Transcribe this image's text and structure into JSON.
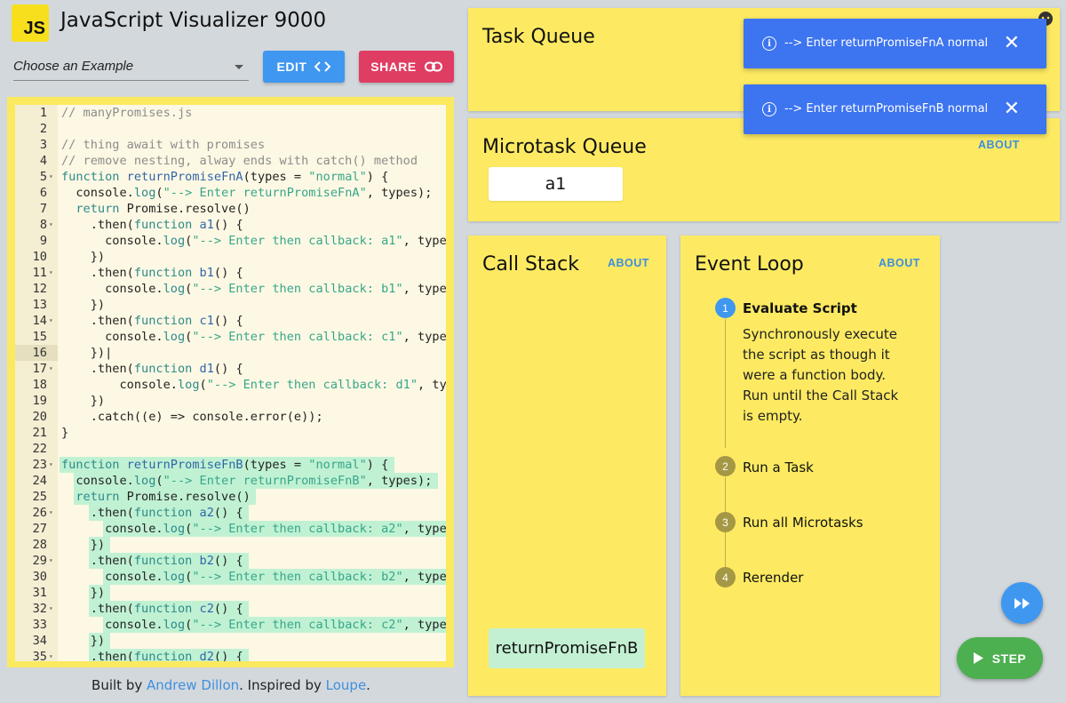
{
  "app": {
    "logo_text": "JS",
    "title": "JavaScript Visualizer 9000"
  },
  "toolbar": {
    "example_placeholder": "Choose an Example",
    "edit_label": "EDIT",
    "share_label": "SHARE"
  },
  "editor": {
    "active_line": 16,
    "highlight_start": 23,
    "lines": [
      {
        "n": "1",
        "fold": "",
        "code": "// manyPromises.js",
        "kind": "comment"
      },
      {
        "n": "2",
        "fold": "",
        "code": "",
        "kind": "plain"
      },
      {
        "n": "3",
        "fold": "",
        "code": "// thing await with promises",
        "kind": "comment"
      },
      {
        "n": "4",
        "fold": "",
        "code": "// remove nesting, alway ends with catch() method",
        "kind": "comment"
      },
      {
        "n": "5",
        "fold": "▾",
        "code": "function returnPromiseFnA(types = \"normal\") {",
        "kind": "fndecl"
      },
      {
        "n": "6",
        "fold": "",
        "code": "  console.log(\"--> Enter returnPromiseFnA\", types);",
        "kind": "log"
      },
      {
        "n": "7",
        "fold": "",
        "code": "  return Promise.resolve()",
        "kind": "return"
      },
      {
        "n": "8",
        "fold": "▾",
        "code": "    .then(function a1() {",
        "kind": "then"
      },
      {
        "n": "9",
        "fold": "",
        "code": "      console.log(\"--> Enter then callback: a1\", type",
        "kind": "log"
      },
      {
        "n": "10",
        "fold": "",
        "code": "    })",
        "kind": "plain"
      },
      {
        "n": "11",
        "fold": "▾",
        "code": "    .then(function b1() {",
        "kind": "then"
      },
      {
        "n": "12",
        "fold": "",
        "code": "      console.log(\"--> Enter then callback: b1\", type",
        "kind": "log"
      },
      {
        "n": "13",
        "fold": "",
        "code": "    })",
        "kind": "plain"
      },
      {
        "n": "14",
        "fold": "▾",
        "code": "    .then(function c1() {",
        "kind": "then"
      },
      {
        "n": "15",
        "fold": "",
        "code": "      console.log(\"--> Enter then callback: c1\", type",
        "kind": "log"
      },
      {
        "n": "16",
        "fold": "",
        "code": "    })|",
        "kind": "plain"
      },
      {
        "n": "17",
        "fold": "▾",
        "code": "    .then(function d1() {",
        "kind": "then"
      },
      {
        "n": "18",
        "fold": "",
        "code": "        console.log(\"--> Enter then callback: d1\", ty",
        "kind": "log"
      },
      {
        "n": "19",
        "fold": "",
        "code": "    })",
        "kind": "plain"
      },
      {
        "n": "20",
        "fold": "",
        "code": "    .catch((e) => console.error(e));",
        "kind": "plain"
      },
      {
        "n": "21",
        "fold": "",
        "code": "}",
        "kind": "plain"
      },
      {
        "n": "22",
        "fold": "",
        "code": "",
        "kind": "plain"
      },
      {
        "n": "23",
        "fold": "▾",
        "code": "function returnPromiseFnB(types = \"normal\") {",
        "kind": "fndecl"
      },
      {
        "n": "24",
        "fold": "",
        "code": "  console.log(\"--> Enter returnPromiseFnB\", types);",
        "kind": "log"
      },
      {
        "n": "25",
        "fold": "",
        "code": "  return Promise.resolve()",
        "kind": "return"
      },
      {
        "n": "26",
        "fold": "▾",
        "code": "    .then(function a2() {",
        "kind": "then"
      },
      {
        "n": "27",
        "fold": "",
        "code": "      console.log(\"--> Enter then callback: a2\", type",
        "kind": "log"
      },
      {
        "n": "28",
        "fold": "",
        "code": "    })",
        "kind": "plain"
      },
      {
        "n": "29",
        "fold": "▾",
        "code": "    .then(function b2() {",
        "kind": "then"
      },
      {
        "n": "30",
        "fold": "",
        "code": "      console.log(\"--> Enter then callback: b2\", type",
        "kind": "log"
      },
      {
        "n": "31",
        "fold": "",
        "code": "    })",
        "kind": "plain"
      },
      {
        "n": "32",
        "fold": "▾",
        "code": "    .then(function c2() {",
        "kind": "then"
      },
      {
        "n": "33",
        "fold": "",
        "code": "      console.log(\"--> Enter then callback: c2\", type",
        "kind": "log"
      },
      {
        "n": "34",
        "fold": "",
        "code": "    })",
        "kind": "plain"
      },
      {
        "n": "35",
        "fold": "▾",
        "code": "    .then(function d2() {",
        "kind": "then"
      }
    ]
  },
  "footer": {
    "prefix": "Built by ",
    "author": "Andrew Dillon",
    "middle": ". Inspired by ",
    "inspiration": "Loupe",
    "suffix": "."
  },
  "task_queue": {
    "title": "Task Queue"
  },
  "microtask_queue": {
    "title": "Microtask Queue",
    "about": "ABOUT",
    "items": [
      "a1"
    ]
  },
  "call_stack": {
    "title": "Call Stack",
    "about": "ABOUT",
    "items": [
      "returnPromiseFnB"
    ]
  },
  "event_loop": {
    "title": "Event Loop",
    "about": "ABOUT",
    "steps": [
      {
        "num": "1",
        "label": "Evaluate Script",
        "active": true,
        "desc": "Synchronously execute the script as though it were a function body. Run until the Call Stack is empty."
      },
      {
        "num": "2",
        "label": "Run a Task",
        "active": false
      },
      {
        "num": "3",
        "label": "Run all Microtasks",
        "active": false
      },
      {
        "num": "4",
        "label": "Rerender",
        "active": false
      }
    ]
  },
  "toasts": [
    {
      "message": "--> Enter returnPromiseFnA normal",
      "close": "✕"
    },
    {
      "message": "--> Enter returnPromiseFnB normal",
      "close": "✕"
    }
  ],
  "controls": {
    "step_label": "STEP"
  },
  "colors": {
    "accent_blue": "#3f97f0",
    "share_red": "#e03d63",
    "panel_yellow": "#fdea62",
    "step_green": "#4caf50",
    "toast_blue": "#3d74f0"
  }
}
